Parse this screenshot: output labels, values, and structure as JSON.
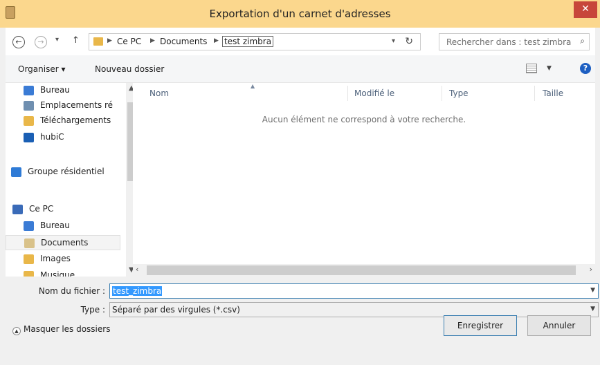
{
  "window": {
    "title": "Exportation d'un carnet d'adresses",
    "close_glyph": "✕"
  },
  "address_bar": {
    "breadcrumbs": [
      "Ce PC",
      "Documents",
      "test zimbra"
    ],
    "search_placeholder": "Rechercher dans : test zimbra"
  },
  "toolbar": {
    "organize_label": "Organiser ▾",
    "new_folder_label": "Nouveau dossier"
  },
  "nav_pane": {
    "items": [
      {
        "label": "Bureau",
        "icon": "desktop-icon",
        "color": "#3a7bd5"
      },
      {
        "label": "Emplacements ré",
        "icon": "network-places-icon",
        "color": "#6f8fb0"
      },
      {
        "label": "Téléchargements",
        "icon": "downloads-folder-icon",
        "color": "#e9b749"
      },
      {
        "label": "hubiC",
        "icon": "hubic-icon",
        "color": "#1a5fb4"
      },
      {
        "label": "Groupe résidentiel",
        "icon": "homegroup-icon",
        "color": "#2f7bd6"
      },
      {
        "label": "Ce PC",
        "icon": "computer-icon",
        "color": "#3a6bb8"
      },
      {
        "label": "Bureau",
        "icon": "desktop-folder-icon",
        "color": "#3a7bd5"
      },
      {
        "label": "Documents",
        "icon": "documents-folder-icon",
        "color": "#d9c28a"
      },
      {
        "label": "Images",
        "icon": "pictures-folder-icon",
        "color": "#e9b749"
      },
      {
        "label": "Musique",
        "icon": "music-folder-icon",
        "color": "#e9b749"
      }
    ]
  },
  "file_list": {
    "columns": [
      "Nom",
      "Modifié le",
      "Type",
      "Taille"
    ],
    "empty_message": "Aucun élément ne correspond à votre recherche."
  },
  "form": {
    "filename_label": "Nom du fichier :",
    "filename_value": "test_zimbra",
    "type_label": "Type :",
    "type_value": "Séparé par des virgules (*.csv)"
  },
  "footer": {
    "hide_folders_label": "Masquer les dossiers",
    "save_label": "Enregistrer",
    "cancel_label": "Annuler"
  }
}
